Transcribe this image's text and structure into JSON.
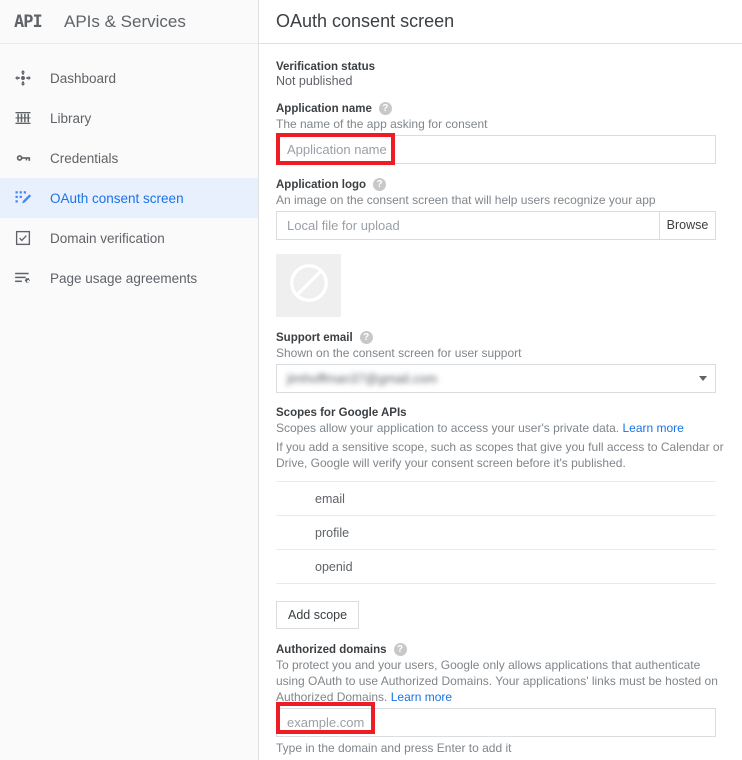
{
  "sidebar": {
    "logo_text": "API",
    "brand_title": "APIs & Services",
    "items": [
      {
        "label": "Dashboard",
        "icon": "dashboard-icon",
        "active": false
      },
      {
        "label": "Library",
        "icon": "library-icon",
        "active": false
      },
      {
        "label": "Credentials",
        "icon": "key-icon",
        "active": false
      },
      {
        "label": "OAuth consent screen",
        "icon": "oauth-consent-icon",
        "active": true
      },
      {
        "label": "Domain verification",
        "icon": "checkbox-icon",
        "active": false
      },
      {
        "label": "Page usage agreements",
        "icon": "lines-gear-icon",
        "active": false
      }
    ],
    "active_color": "#1a73e8",
    "active_bg": "#e8f0fe"
  },
  "header": {
    "page_title": "OAuth consent screen"
  },
  "form": {
    "verification": {
      "label": "Verification status",
      "value": "Not published"
    },
    "application_name": {
      "label": "Application name",
      "help_icon": "help-icon",
      "helper": "The name of the app asking for consent",
      "placeholder": "Application name",
      "value": ""
    },
    "application_logo": {
      "label": "Application logo",
      "help_icon": "help-icon",
      "helper": "An image on the consent screen that will help users recognize your app",
      "placeholder": "Local file for upload",
      "value": "",
      "browse_label": "Browse",
      "preview_icon": "no-image-icon"
    },
    "support_email": {
      "label": "Support email",
      "help_icon": "help-icon",
      "helper": "Shown on the consent screen for user support",
      "selected": "jimhoffman37@gmail.com",
      "caret_icon": "chevron-down-icon"
    },
    "scopes": {
      "label": "Scopes for Google APIs",
      "helper_line1": "Scopes allow your application to access your user's private data.",
      "learn_more": "Learn more",
      "helper_line2": "If you add a sensitive scope, such as scopes that give you full access to Calendar or Drive, Google will verify your consent screen before it's published.",
      "rows": [
        "email",
        "profile",
        "openid"
      ],
      "add_scope_label": "Add scope"
    },
    "authorized_domains": {
      "label": "Authorized domains",
      "help_icon": "help-icon",
      "helper": "To protect you and your users, Google only allows applications that authenticate using OAuth to use Authorized Domains. Your applications' links must be hosted on Authorized Domains.",
      "learn_more": "Learn more",
      "placeholder": "example.com",
      "value": "",
      "hint": "Type in the domain and press Enter to add it"
    }
  },
  "annotations": {
    "color": "#ee1c24",
    "boxes": [
      "application-name-input",
      "authorized-domains-input"
    ]
  }
}
